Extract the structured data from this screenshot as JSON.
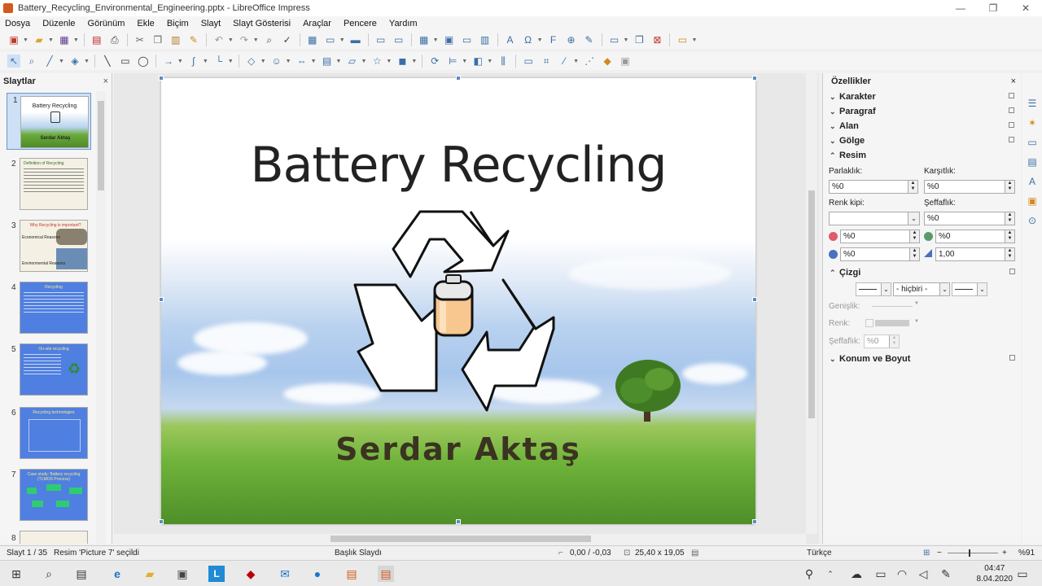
{
  "window": {
    "title": "Battery_Recycling_Environmental_Engineering.pptx - LibreOffice Impress",
    "controls": [
      "—",
      "❐",
      "✕"
    ]
  },
  "menubar": [
    "Dosya",
    "Düzenle",
    "Görünüm",
    "Ekle",
    "Biçim",
    "Slayt",
    "Slayt Gösterisi",
    "Araçlar",
    "Pencere",
    "Yardım"
  ],
  "slides_panel": {
    "title": "Slaytlar",
    "close": "×",
    "thumbs": [
      {
        "num": "1",
        "title": "Battery Recycling",
        "subtitle": "Serdar Aktaş"
      },
      {
        "num": "2",
        "title": "Definition of Recycling"
      },
      {
        "num": "3",
        "title": "Why Recycling is important?",
        "a": "Economical Reasons",
        "b": "Environmental Reasons"
      },
      {
        "num": "4",
        "title": "Recycling"
      },
      {
        "num": "5",
        "title": "On-site recycling"
      },
      {
        "num": "6",
        "title": "Recycling technologies"
      },
      {
        "num": "7",
        "title": "Case study: Battery recycling (TLMOS Process)"
      },
      {
        "num": "8"
      }
    ]
  },
  "slide": {
    "title": "Battery Recycling",
    "subtitle": "Serdar Aktaş"
  },
  "properties": {
    "header": "Özellikler",
    "close": "×",
    "sections": [
      "Karakter",
      "Paragraf",
      "Alan",
      "Gölge",
      "Resim"
    ],
    "image": {
      "brightness_label": "Parlaklık:",
      "brightness": "%0",
      "contrast_label": "Karşıtlık:",
      "contrast": "%0",
      "color_mode_label": "Renk kipi:",
      "transparency_label": "Şeffaflık:",
      "transparency": "%0",
      "red": "%0",
      "green": "%0",
      "blue": "%0",
      "gamma": "1,00"
    },
    "line": {
      "title": "Çizgi",
      "style": "- hiçbiri -",
      "width_label": "Genişlik:",
      "color_label": "Renk:",
      "transparency_label": "Şeffaflık:",
      "transparency": "%0"
    },
    "position_section": "Konum ve Boyut"
  },
  "statusbar": {
    "slide": "Slayt 1 / 35",
    "selection": "Resim 'Picture 7' seçildi",
    "layout": "Başlık Slaydı",
    "position": "0,00 / -0,03",
    "size": "25,40 x 19,05",
    "language": "Türkçe",
    "zoom": "%91"
  },
  "taskbar": {
    "time": "04:47",
    "date": "8.04.2020"
  }
}
